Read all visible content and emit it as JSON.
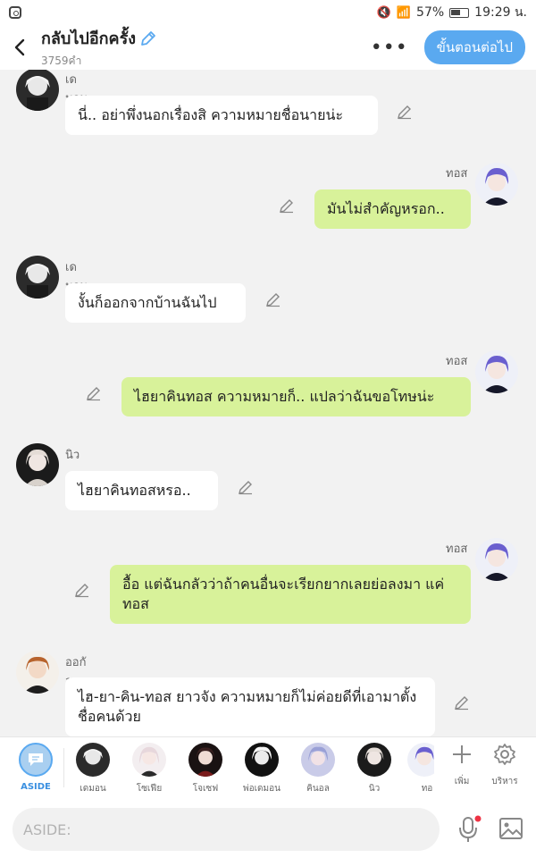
{
  "status_bar": {
    "battery": "57%",
    "time": "19:29 น."
  },
  "header": {
    "title": "กลับไปอีกครั้ง",
    "word_count": "3759คำ",
    "next_label": "ขั้นตอนต่อไป"
  },
  "messages": [
    {
      "side": "left",
      "name": "เดมอน",
      "text": "นี่.. อย่าพึ่งนอกเรื่องสิ ความหมายชื่อนายน่ะ"
    },
    {
      "side": "right",
      "name": "ทอส",
      "text": "มันไม่สำคัญหรอก.."
    },
    {
      "side": "left",
      "name": "เดมอน",
      "text": "งั้นก็ออกจากบ้านฉันไป"
    },
    {
      "side": "right",
      "name": "ทอส",
      "text": "ไฮยาคินทอส ความหมายก็.. แปลว่าฉันขอโทษน่ะ"
    },
    {
      "side": "left",
      "name": "นิว",
      "text": "ไฮยาคินทอสหรอ.."
    },
    {
      "side": "right",
      "name": "ทอส",
      "text": "อื้อ แต่ฉันกลัวว่าถ้าคนอื่นจะเรียกยากเลยย่อลงมา แค่ทอส"
    },
    {
      "side": "left",
      "name": "ออกัส",
      "text": "ไฮ-ยา-คิน-ทอส ยาวจัง ความหมายก็ไม่ค่อยดีที่เอามาตั้งชื่อคนด้วย"
    }
  ],
  "character_bar": {
    "aside_label": "ASIDE",
    "characters": [
      "เดมอน",
      "โซเฟีย",
      "โจเซฟ",
      "พ่อเดมอน",
      "คินอล",
      "นิว",
      "ทอ"
    ],
    "add_label": "เพิ่ม",
    "manage_label": "บริหาร"
  },
  "input": {
    "placeholder": "ASIDE:"
  },
  "colors": {
    "accent": "#5aa9f0",
    "bubble_right": "#d8f29a",
    "bubble_left": "#ffffff",
    "background": "#f2f2f2"
  }
}
